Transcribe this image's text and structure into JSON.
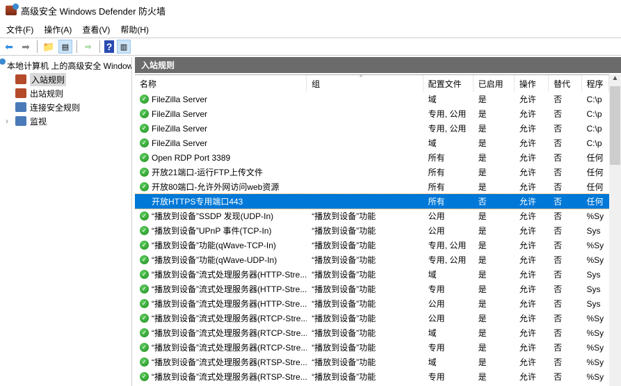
{
  "window": {
    "title": "高级安全 Windows Defender 防火墙"
  },
  "menu": [
    "文件(F)",
    "操作(A)",
    "查看(V)",
    "帮助(H)"
  ],
  "toolbar": {
    "icons": [
      "back-arrow-icon",
      "forward-arrow-icon",
      "up-folder-icon",
      "show-hide-console-tree-icon",
      "export-list-icon",
      "help-icon",
      "show-hide-action-pane-icon"
    ]
  },
  "tree": {
    "root": "本地计算机 上的高级安全 Windows Defender 防火墙",
    "items": [
      "入站规则",
      "出站规则",
      "连接安全规则",
      "监视"
    ]
  },
  "pane": {
    "title": "入站规则",
    "columns": [
      "名称",
      "组",
      "配置文件",
      "已启用",
      "操作",
      "替代",
      "程序"
    ]
  },
  "rows": [
    [
      "FileZilla Server",
      "",
      "域",
      "是",
      "允许",
      "否",
      "C:\\p"
    ],
    [
      "FileZilla Server",
      "",
      "专用, 公用",
      "是",
      "允许",
      "否",
      "C:\\p"
    ],
    [
      "FileZilla Server",
      "",
      "专用, 公用",
      "是",
      "允许",
      "否",
      "C:\\p"
    ],
    [
      "FileZilla Server",
      "",
      "域",
      "是",
      "允许",
      "否",
      "C:\\p"
    ],
    [
      "Open RDP Port 3389",
      "",
      "所有",
      "是",
      "允许",
      "否",
      "任何"
    ],
    [
      "开放21端口-运行FTP上传文件",
      "",
      "所有",
      "是",
      "允许",
      "否",
      "任何"
    ],
    [
      "开放80端口-允许外网访问web资源",
      "",
      "所有",
      "是",
      "允许",
      "否",
      "任何"
    ],
    [
      "开放HTTPS专用端口443",
      "",
      "所有",
      "否",
      "允许",
      "否",
      "任何"
    ],
    [
      "“播放到设备”SSDP 发现(UDP-In)",
      "“播放到设备”功能",
      "公用",
      "是",
      "允许",
      "否",
      "%Sy"
    ],
    [
      "“播放到设备”UPnP 事件(TCP-In)",
      "“播放到设备”功能",
      "公用",
      "是",
      "允许",
      "否",
      "Sys"
    ],
    [
      "“播放到设备”功能(qWave-TCP-In)",
      "“播放到设备”功能",
      "专用, 公用",
      "是",
      "允许",
      "否",
      "%Sy"
    ],
    [
      "“播放到设备”功能(qWave-UDP-In)",
      "“播放到设备”功能",
      "专用, 公用",
      "是",
      "允许",
      "否",
      "%Sy"
    ],
    [
      "“播放到设备”流式处理服务器(HTTP-Stre...",
      "“播放到设备”功能",
      "域",
      "是",
      "允许",
      "否",
      "Sys"
    ],
    [
      "“播放到设备”流式处理服务器(HTTP-Stre...",
      "“播放到设备”功能",
      "专用",
      "是",
      "允许",
      "否",
      "Sys"
    ],
    [
      "“播放到设备”流式处理服务器(HTTP-Stre...",
      "“播放到设备”功能",
      "公用",
      "是",
      "允许",
      "否",
      "Sys"
    ],
    [
      "“播放到设备”流式处理服务器(RTCP-Stre...",
      "“播放到设备”功能",
      "公用",
      "是",
      "允许",
      "否",
      "%Sy"
    ],
    [
      "“播放到设备”流式处理服务器(RTCP-Stre...",
      "“播放到设备”功能",
      "域",
      "是",
      "允许",
      "否",
      "%Sy"
    ],
    [
      "“播放到设备”流式处理服务器(RTCP-Stre...",
      "“播放到设备”功能",
      "专用",
      "是",
      "允许",
      "否",
      "%Sy"
    ],
    [
      "“播放到设备”流式处理服务器(RTSP-Stre...",
      "“播放到设备”功能",
      "域",
      "是",
      "允许",
      "否",
      "%Sy"
    ],
    [
      "“播放到设备”流式处理服务器(RTSP-Stre...",
      "“播放到设备”功能",
      "专用",
      "是",
      "允许",
      "否",
      "%Sy"
    ]
  ],
  "enabled_flags": [
    true,
    true,
    true,
    true,
    true,
    true,
    true,
    false,
    true,
    true,
    true,
    true,
    true,
    true,
    true,
    true,
    true,
    true,
    true,
    true
  ],
  "selected_row": 7,
  "colors": {
    "selection": "#0078d7",
    "pane_header": "#6b6b6b"
  }
}
